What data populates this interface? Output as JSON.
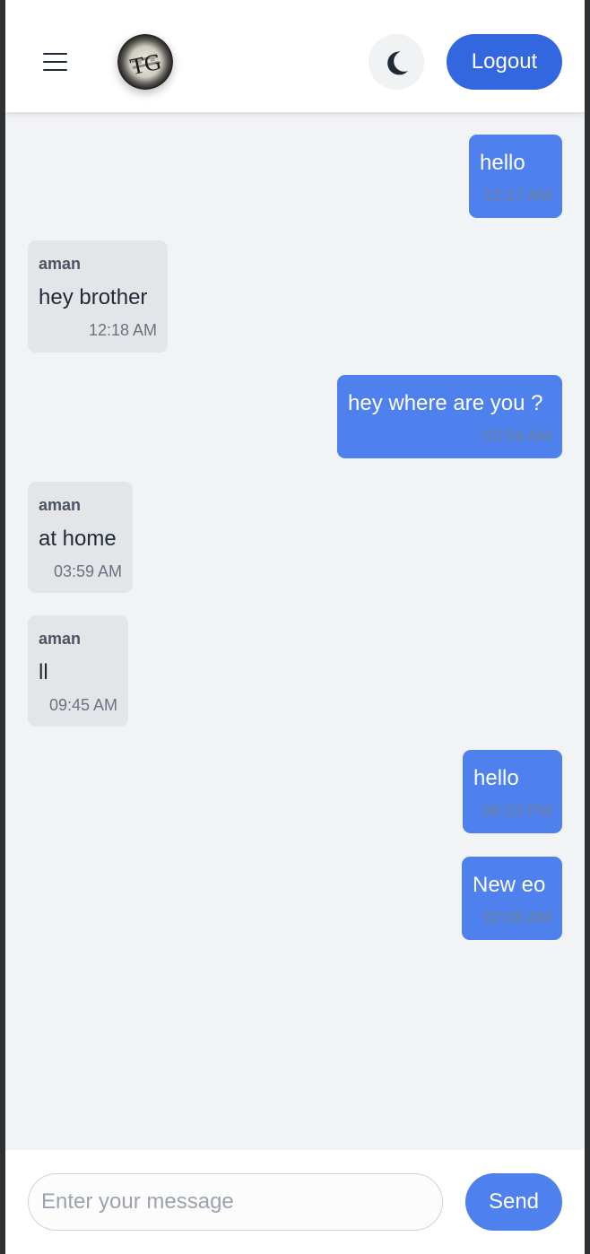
{
  "header": {
    "logo_text": "TG",
    "logout_label": "Logout"
  },
  "icons": {
    "menu": "hamburger-menu-icon",
    "theme": "moon-icon"
  },
  "colors": {
    "accent": "#3367e0",
    "outgoing_bubble": "#4e81ee",
    "incoming_bubble": "#e4e5e8",
    "chat_background": "#f2f3f5"
  },
  "messages": [
    {
      "direction": "out",
      "text": "hello",
      "time": "12:17 AM"
    },
    {
      "direction": "in",
      "sender": "aman",
      "text": "hey brother",
      "time": "12:18 AM"
    },
    {
      "direction": "out",
      "text": "hey where are you ?",
      "time": "03:59 AM"
    },
    {
      "direction": "in",
      "sender": "aman",
      "text": "at home",
      "time": "03:59 AM"
    },
    {
      "direction": "in",
      "sender": "aman",
      "text": "ll",
      "time": "09:45 AM"
    },
    {
      "direction": "out",
      "text": "hello",
      "time": "06:23 PM"
    },
    {
      "direction": "out",
      "text": "New eo",
      "time": "02:08 AM"
    }
  ],
  "composer": {
    "placeholder": "Enter your message",
    "value": "",
    "send_label": "Send"
  }
}
